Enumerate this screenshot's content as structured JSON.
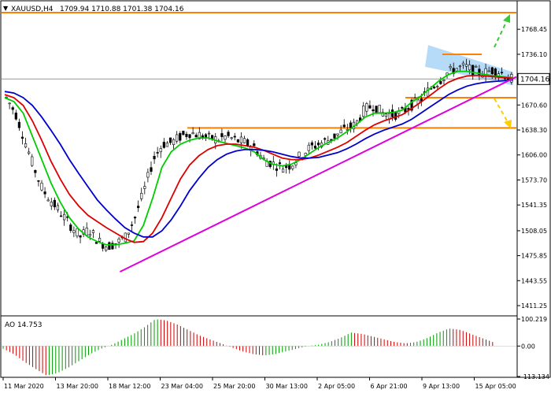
{
  "header": {
    "symbol_timeframe": "XAUUSD,H4",
    "ohlc": "1709.94 1710.88 1701.38 1704.16"
  },
  "chart_data": [
    {
      "type": "candlestick",
      "panel": "price",
      "y_ticks": [
        "1768.45",
        "1736.10",
        "1703.75",
        "1670.60",
        "1638.30",
        "1606.00",
        "1573.70",
        "1541.35",
        "1508.05",
        "1475.85",
        "1443.55",
        "1411.25"
      ],
      "ylim": [
        1411.25,
        1790
      ],
      "current_price_label": "1704.16",
      "current_price": 1704.16,
      "x_labels": [
        "11 Mar 2020",
        "13 Mar 20:00",
        "18 Mar 12:00",
        "23 Mar 04:00",
        "25 Mar 20:00",
        "30 Mar 13:00",
        "2 Apr 05:00",
        "6 Apr 21:00",
        "9 Apr 13:00",
        "15 Apr 05:00"
      ],
      "close_path": [
        1680,
        1660,
        1625,
        1590,
        1560,
        1545,
        1530,
        1515,
        1500,
        1510,
        1495,
        1488,
        1492,
        1500,
        1525,
        1560,
        1600,
        1620,
        1622,
        1630,
        1635,
        1632,
        1628,
        1626,
        1630,
        1625,
        1622,
        1616,
        1600,
        1595,
        1590,
        1593,
        1605,
        1615,
        1620,
        1625,
        1632,
        1640,
        1645,
        1665,
        1670,
        1660,
        1658,
        1660,
        1670,
        1675,
        1690,
        1700,
        1712,
        1718,
        1720,
        1714,
        1712,
        1716,
        1712,
        1704
      ],
      "series": [
        {
          "name": "MA fast",
          "color": "#00cc00",
          "values": [
            1680,
            1675,
            1660,
            1630,
            1600,
            1570,
            1545,
            1525,
            1510,
            1500,
            1494,
            1490,
            1490,
            1492,
            1495,
            1515,
            1550,
            1590,
            1610,
            1620,
            1625,
            1628,
            1628,
            1624,
            1621,
            1618,
            1615,
            1610,
            1600,
            1594,
            1592,
            1594,
            1600,
            1608,
            1616,
            1622,
            1628,
            1636,
            1645,
            1655,
            1660,
            1660,
            1661,
            1664,
            1674,
            1682,
            1692,
            1702,
            1710,
            1714,
            1714,
            1712,
            1710,
            1708,
            1707,
            1706
          ]
        },
        {
          "name": "MA medium",
          "color": "#dd0000",
          "values": [
            1684,
            1680,
            1670,
            1650,
            1625,
            1598,
            1575,
            1555,
            1540,
            1528,
            1520,
            1512,
            1505,
            1498,
            1493,
            1494,
            1505,
            1525,
            1550,
            1575,
            1593,
            1605,
            1613,
            1618,
            1620,
            1620,
            1618,
            1616,
            1612,
            1607,
            1602,
            1600,
            1600,
            1602,
            1606,
            1611,
            1616,
            1622,
            1630,
            1638,
            1645,
            1650,
            1654,
            1658,
            1666,
            1674,
            1683,
            1692,
            1700,
            1705,
            1708,
            1709,
            1708,
            1707,
            1706,
            1705
          ]
        },
        {
          "name": "MA slow",
          "color": "#0000cc",
          "values": [
            1688,
            1686,
            1680,
            1670,
            1655,
            1638,
            1620,
            1600,
            1582,
            1565,
            1548,
            1535,
            1523,
            1512,
            1505,
            1500,
            1500,
            1508,
            1522,
            1540,
            1560,
            1576,
            1590,
            1600,
            1607,
            1611,
            1613,
            1613,
            1612,
            1610,
            1607,
            1604,
            1602,
            1602,
            1603,
            1606,
            1609,
            1614,
            1620,
            1627,
            1633,
            1638,
            1642,
            1646,
            1652,
            1660,
            1668,
            1676,
            1684,
            1690,
            1695,
            1698,
            1700,
            1701,
            1702,
            1703
          ]
        }
      ],
      "annotations": {
        "horizontal_levels": [
          1790,
          1736,
          1680,
          1641
        ],
        "trendline": {
          "from": [
            0.23,
            1455
          ],
          "to": [
            1.0,
            1707
          ]
        },
        "level_color": "#ff7f00",
        "trendline_color": "#dd00dd",
        "channel_color": "#9ecff5",
        "up_arrow_color": "#33cc33",
        "down_arrow_color": "#ffcc00"
      }
    },
    {
      "type": "bar",
      "panel": "oscillator",
      "label": "AO 14.753",
      "y_ticks": [
        "100.219",
        "0.00",
        "-113.134"
      ],
      "ylim": [
        -113.134,
        100.219
      ],
      "up_color": "#009900",
      "down_color": "#cc0000",
      "values_path": [
        -10,
        -30,
        -60,
        -85,
        -110,
        -100,
        -80,
        -55,
        -30,
        -10,
        5,
        25,
        45,
        70,
        100,
        95,
        80,
        60,
        40,
        25,
        10,
        -5,
        -20,
        -30,
        -35,
        -30,
        -20,
        -10,
        0,
        5,
        15,
        30,
        50,
        45,
        35,
        25,
        15,
        10,
        15,
        30,
        50,
        65,
        60,
        45,
        30,
        15
      ]
    }
  ]
}
